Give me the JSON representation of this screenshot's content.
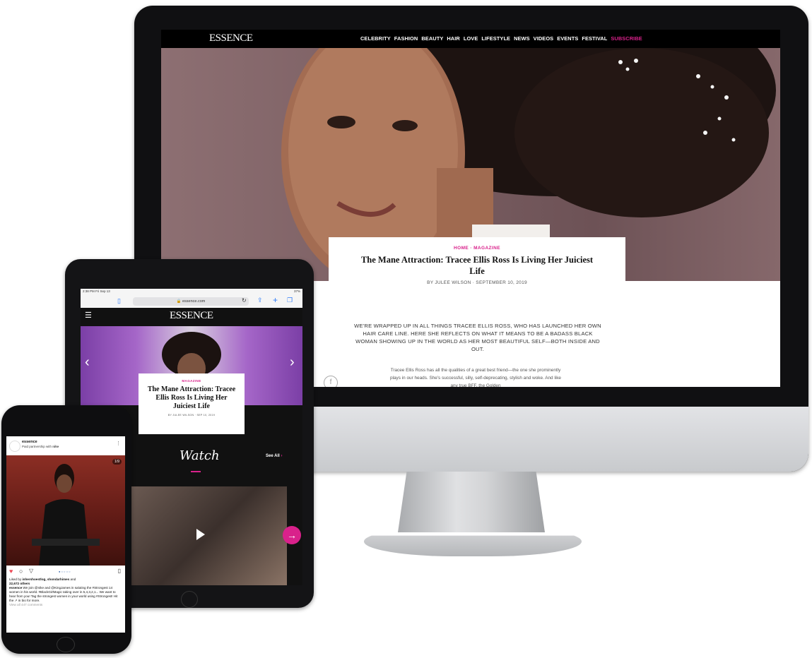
{
  "desktop": {
    "site": {
      "logo": "ESSENCE",
      "nav": [
        "CELEBRITY",
        "FASHION",
        "BEAUTY",
        "HAIR",
        "LOVE",
        "LIFESTYLE",
        "NEWS",
        "VIDEOS",
        "EVENTS",
        "FESTIVAL"
      ],
      "subscribe_label": "SUBSCRIBE"
    },
    "article": {
      "breadcrumb": "HOME · MAGAZINE",
      "headline": "The Mane Attraction: Tracee Ellis Ross Is Living Her Juiciest Life",
      "byline": "BY JULEE WILSON  ·  SEPTEMBER 10, 2019",
      "dek": "WE'RE WRAPPED UP IN ALL THINGS TRACEE ELLIS ROSS, WHO HAS LAUNCHED HER OWN HAIR CARE LINE. HERE SHE REFLECTS ON WHAT IT MEANS TO BE A BADASS BLACK WOMAN SHOWING UP IN THE WORLD AS HER MOST BEAUTIFUL SELF—BOTH INSIDE AND OUT.",
      "body": "Tracee Ellis Ross has all the qualities of a great best friend—the one she prominently plays in our heads. She's successful, silly, self-deprecating, stylish and woke. And like any true BFF, the Golden",
      "share_icon": "facebook-icon"
    }
  },
  "tablet": {
    "status_time": "2:38 PM  Fri Sep 13",
    "status_right": "37%",
    "url": "essence.com",
    "logo": "ESSENCE",
    "hero_card": {
      "breadcrumb": "MAGAZINE",
      "headline": "The Mane Attraction: Tracee Ellis Ross Is Living Her Juiciest Life",
      "byline": "BY JULEE WILSON · SEP 10, 2019"
    },
    "section_title": "Watch",
    "see_all": "See All",
    "accent": "#d9218b"
  },
  "phone": {
    "account": "essence",
    "subtitle": "Paid partnership with ",
    "partner": "nike",
    "counter": "1/9",
    "likes_line": "Liked by ",
    "likers": "inhershoestlog, shondarhimes",
    "likes_and": " and",
    "likes_count": "22,672 others",
    "caption_user": "essence",
    "caption": " We join @nike and @KingJames in saluting the #Strongest 14 women in his world. #BlackGirlMagic taking over in 5,4,3,2,1... We want to hear from you! Tag the strongest women in your world using #Strongest! Hit the ↗ in bio for more.",
    "comments": "View all 447 comments"
  }
}
